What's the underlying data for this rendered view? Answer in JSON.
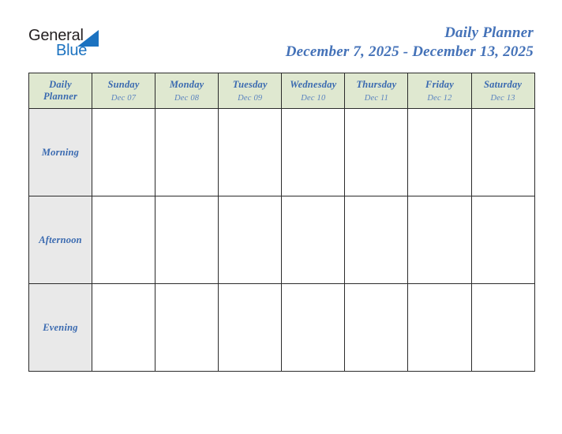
{
  "brand": {
    "name_part1": "General",
    "name_part2": "Blue",
    "triangle_color": "#1b72c0",
    "text_color_part1": "#231f20",
    "text_color_part2": "#1b72c0"
  },
  "header": {
    "title": "Daily Planner",
    "date_range": "December 7, 2025 - December 13, 2025",
    "title_color": "#4472b8"
  },
  "table": {
    "corner_label_line1": "Daily",
    "corner_label_line2": "Planner",
    "header_background": "#dfe8d0",
    "row_label_background": "#e9e9e9",
    "cell_background": "#ffffff",
    "border_color": "#2b2b2b",
    "accent_text_color": "#3a6ab0",
    "columns": [
      {
        "day": "Sunday",
        "date": "Dec 07"
      },
      {
        "day": "Monday",
        "date": "Dec 08"
      },
      {
        "day": "Tuesday",
        "date": "Dec 09"
      },
      {
        "day": "Wednesday",
        "date": "Dec 10"
      },
      {
        "day": "Thursday",
        "date": "Dec 11"
      },
      {
        "day": "Friday",
        "date": "Dec 12"
      },
      {
        "day": "Saturday",
        "date": "Dec 13"
      }
    ],
    "rows": [
      {
        "label": "Morning",
        "cells": [
          "",
          "",
          "",
          "",
          "",
          "",
          ""
        ]
      },
      {
        "label": "Afternoon",
        "cells": [
          "",
          "",
          "",
          "",
          "",
          "",
          ""
        ]
      },
      {
        "label": "Evening",
        "cells": [
          "",
          "",
          "",
          "",
          "",
          "",
          ""
        ]
      }
    ]
  }
}
